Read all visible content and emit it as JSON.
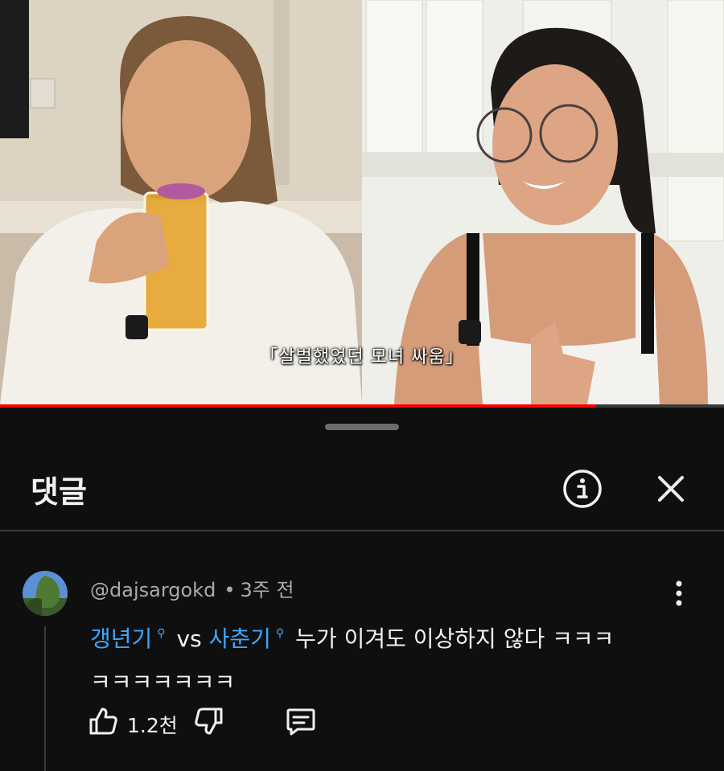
{
  "video": {
    "subtitle": "「살벌했었던 모녀 싸움」",
    "progress": 0.823
  },
  "sheet": {
    "title": "댓글"
  },
  "comment": {
    "author": "@dajsargokd",
    "separator": "•",
    "time": "3주 전",
    "mention1": "갱년기",
    "vs": "vs",
    "mention2": "사춘기",
    "text_line1": "누가 이겨도 이상하지 않다 ㅋㅋㅋ",
    "text_line2": "ㅋㅋㅋㅋㅋㅋㅋ",
    "likes": "1.2천"
  },
  "colors": {
    "background": "#0f0f0f",
    "link": "#3ea6ff",
    "progress": "#ff0000",
    "muted": "#aaaaaa"
  },
  "icons": [
    "info-icon",
    "close-icon",
    "more-vertical-icon",
    "search-icon",
    "thumbs-up-icon",
    "thumbs-down-icon",
    "reply-icon"
  ]
}
